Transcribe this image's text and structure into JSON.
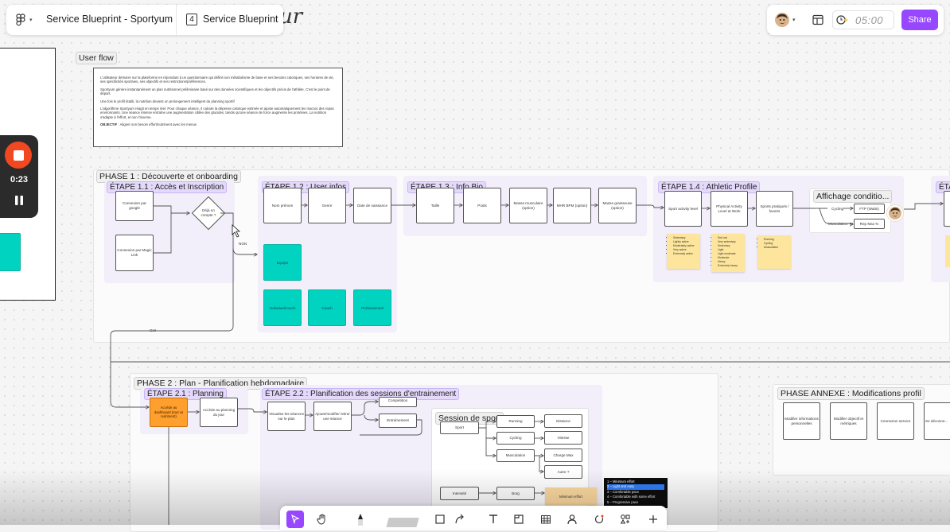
{
  "header": {
    "figma_menu_icon": "figma-logo-icon",
    "file_title": "Service Blueprint - Sportyum",
    "page_number": "4",
    "page_name": "Service Blueprint",
    "cursive_label": "ur",
    "timer": "05:00",
    "share_label": "Share"
  },
  "recorder": {
    "time": "0:23"
  },
  "userflow": {
    "label": "User flow",
    "p1": "L'utilisateur démarre sur la plateforme en répondant à un questionnaire qui définit son métabolisme de base et ses besoins caloriques, ses horaires de vie, ses spécificités sportives, ses objectifs et ses restrictions/préférences.",
    "p2": "Sportyum génère instantanément un plan nutritionnel préliminaire basé sur des données scientifiques et les objectifs précis de l'athlète. C'est le point de départ.",
    "p3": "Une fois le profil établi, la nutrition devient un prolongement intelligent du planning sportif",
    "p4": "L'algorithme Sportyum réagit en temps réel. Pour chaque séance, il calcule la dépense calorique estimée et ajuste automatiquement les macros des repas environnants. Une séance intense entraîne une augmentation ciblée des glucides, tandis qu'une séance de force augmente les protéines. La nutrition s'adapte à l'effort, et non l'inverse.",
    "objective_label": "OBJECTIF",
    "objective_text": " : Aligner son besoin effort/nutriment avec les menus"
  },
  "phase1": {
    "label": "PHASE 1 : Découverte et onboarding",
    "step11": {
      "label": "ÉTAPE 1.1 : Accès et Inscription",
      "google": "Connexion par google",
      "magic": "Connexion par Magic Link",
      "decision": "Déjà un compte ?",
      "non": "NON",
      "oui": "OUI"
    },
    "step12": {
      "label": "ÉTAPE 1.2 : User infos",
      "nodes": [
        "Nom prénom",
        "Genre",
        "Date de naissance"
      ],
      "teal": [
        "Equipe",
        "Individuel/coach",
        "Coach",
        "Professionnel"
      ]
    },
    "step13": {
      "label": "ÉTAPE 1.3 : Info Bio",
      "nodes": [
        "Taille",
        "Poids",
        "Masse musculaire (option)",
        "MHR BPM (option)",
        "Masse graisseuse (option)"
      ]
    },
    "step14": {
      "label": "ÉTAPE 1.4 : Athletic Profile",
      "nodes": [
        "Sport activity level",
        "Physical Activity Level at Work",
        "Sports pratiqués / favoris"
      ],
      "sticky1": [
        "Sedentary",
        "Lightly active",
        "Moderately active",
        "Very active",
        "Extremely active"
      ],
      "sticky2": [
        "Sed nat",
        "Very sedentary",
        "Sedentary",
        "Light",
        "Light moderate",
        "Moderate",
        "Heavy",
        "Extremely heavy"
      ],
      "sticky3": [
        "Running",
        "Cycling",
        "Musculation"
      ]
    },
    "conditional": {
      "label": "Affichage conditio...",
      "cycling": "Cycling",
      "ftp": "FTP (Watts)",
      "musculation": "Musculation",
      "rep": "Rep Max %"
    },
    "next_step_label": "ÉTA"
  },
  "phase2": {
    "label": "PHASE 2 : Plan - Planification hebdomadaire",
    "step21": {
      "label": "ÉTAPE 2.1 : Planning",
      "orange": "Accède au dashboard (tout vs nutriment)",
      "node": "Accède au planning du jour"
    },
    "step22": {
      "label": "ÉTAPE 2.2 : Planification des sessions d'entrainement",
      "nodes": [
        "Visualise les séances sur le plan",
        "Ajoute/modifie/ retirer une séance",
        "Compétition",
        "Entraînement"
      ]
    },
    "session": {
      "label": "Session de sport",
      "sport": "Sport",
      "types": [
        "Running",
        "Cycling",
        "Musculation"
      ],
      "metrics": [
        "Distance",
        "Vitesse",
        "Charge Max",
        "Autre ?"
      ],
      "intensite": "Intensité",
      "borg": "Borg",
      "minimum": "Minimum effort"
    },
    "scale": [
      "1 – Minimum effort",
      "2 – Light and easy",
      "3 – Comfortable pace",
      "4 – Comfortable with some effort",
      "5 – Progressive pace"
    ]
  },
  "annexe": {
    "label": "PHASE ANNEXE : Modifications profil",
    "nodes": [
      "Modifier informations personnelles",
      "Modifier objectif et métriques",
      "Connexion service",
      "Se déconne..."
    ]
  },
  "colors": {
    "accent": "#9747ff",
    "teal": "#00d4c0",
    "orange": "#ff9f2e",
    "sticky": "#fde59d",
    "stage_bg": "#f2eefa",
    "record": "#f24822"
  }
}
